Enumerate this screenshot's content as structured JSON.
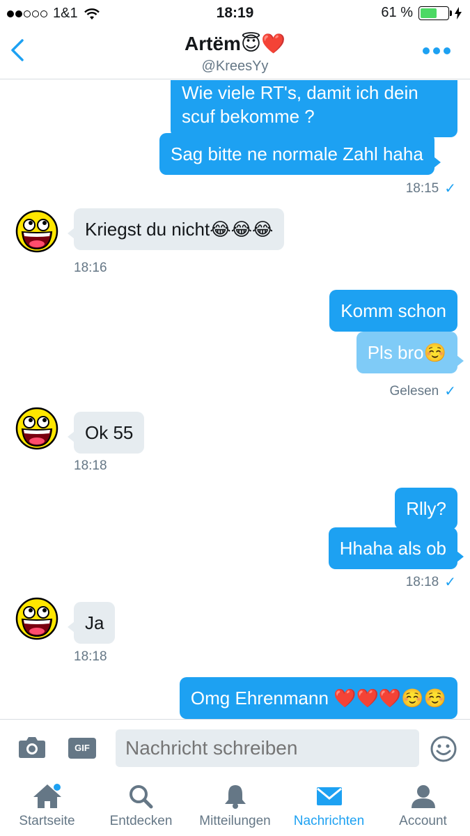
{
  "status_bar": {
    "carrier": "1&1",
    "time": "18:19",
    "battery": "61 %",
    "battery_level": 0.61
  },
  "header": {
    "name": "Artëm😇❤️",
    "handle": "@KreesYy"
  },
  "messages": [
    {
      "dir": "out",
      "text": "Wie viele RT's, damit ich dein scuf bekomme ?"
    },
    {
      "dir": "out",
      "text": "Sag bitte ne normale Zahl haha"
    },
    {
      "dir": "meta",
      "text": "18:15"
    },
    {
      "dir": "in",
      "text": "Kriegst du nicht😂😂😂"
    },
    {
      "dir": "meta",
      "text": "18:16"
    },
    {
      "dir": "out",
      "text": "Komm schon"
    },
    {
      "dir": "out",
      "text": "Pls bro☺️"
    },
    {
      "dir": "meta",
      "text": "Gelesen"
    },
    {
      "dir": "in",
      "text": "Ok 55"
    },
    {
      "dir": "meta",
      "text": "18:18"
    },
    {
      "dir": "out",
      "text": "Rlly?"
    },
    {
      "dir": "out",
      "text": "Hhaha als ob"
    },
    {
      "dir": "meta",
      "text": "18:18"
    },
    {
      "dir": "in",
      "text": "Ja"
    },
    {
      "dir": "meta",
      "text": "18:18"
    },
    {
      "dir": "out",
      "text": "Omg Ehrenmann ❤️❤️❤️☺️☺️"
    }
  ],
  "composer": {
    "placeholder": "Nachricht schreiben",
    "gif_label": "GIF"
  },
  "tabs": [
    {
      "label": "Startseite",
      "icon": "home-icon"
    },
    {
      "label": "Entdecken",
      "icon": "search-icon"
    },
    {
      "label": "Mitteilungen",
      "icon": "bell-icon"
    },
    {
      "label": "Nachrichten",
      "icon": "envelope-icon"
    },
    {
      "label": "Account",
      "icon": "person-icon"
    }
  ],
  "colors": {
    "accent": "#1da1f2",
    "incoming": "#e6ecf0",
    "muted": "#657786"
  }
}
